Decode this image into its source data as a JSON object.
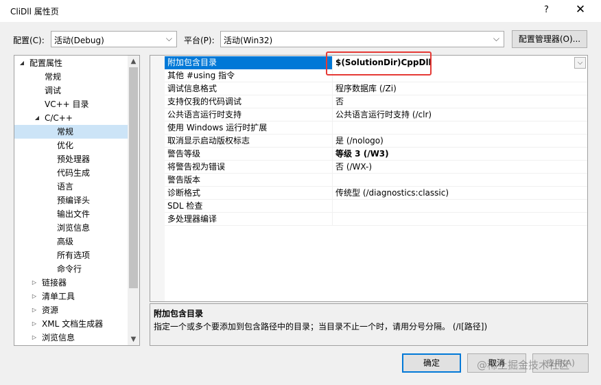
{
  "window": {
    "title": "CliDll 属性页",
    "help_label": "?",
    "close_label": "✕"
  },
  "toolbar": {
    "config_label": "配置(C):",
    "config_value": "活动(Debug)",
    "platform_label": "平台(P):",
    "platform_value": "活动(Win32)",
    "config_manager_label": "配置管理器(O)..."
  },
  "tree": {
    "items": [
      {
        "label": "配置属性",
        "expander": "◢"
      },
      {
        "label": "常规"
      },
      {
        "label": "调试"
      },
      {
        "label": "VC++ 目录"
      },
      {
        "label": "C/C++",
        "expander": "◢"
      },
      {
        "label": "常规"
      },
      {
        "label": "优化"
      },
      {
        "label": "预处理器"
      },
      {
        "label": "代码生成"
      },
      {
        "label": "语言"
      },
      {
        "label": "预编译头"
      },
      {
        "label": "输出文件"
      },
      {
        "label": "浏览信息"
      },
      {
        "label": "高级"
      },
      {
        "label": "所有选项"
      },
      {
        "label": "命令行"
      },
      {
        "label": "链接器",
        "expander": "▷"
      },
      {
        "label": "清单工具",
        "expander": "▷"
      },
      {
        "label": "资源",
        "expander": "▷"
      },
      {
        "label": "XML 文档生成器",
        "expander": "▷"
      },
      {
        "label": "浏览信息",
        "expander": "▷"
      }
    ],
    "selected_index": 5
  },
  "properties": {
    "rows": [
      {
        "name": "附加包含目录",
        "value": "$(SolutionDir)CppDll"
      },
      {
        "name": "其他 #using 指令",
        "value": ""
      },
      {
        "name": "调试信息格式",
        "value": "程序数据库 (/Zi)"
      },
      {
        "name": "支持仅我的代码调试",
        "value": "否"
      },
      {
        "name": "公共语言运行时支持",
        "value": "公共语言运行时支持 (/clr)"
      },
      {
        "name": "使用 Windows 运行时扩展",
        "value": ""
      },
      {
        "name": "取消显示启动版权标志",
        "value": "是 (/nologo)"
      },
      {
        "name": "警告等级",
        "value": "等级 3 (/W3)"
      },
      {
        "name": "将警告视为错误",
        "value": "否 (/WX-)"
      },
      {
        "name": "警告版本",
        "value": ""
      },
      {
        "name": "诊断格式",
        "value": "传统型 (/diagnostics:classic)"
      },
      {
        "name": "SDL 检查",
        "value": ""
      },
      {
        "name": "多处理器编译",
        "value": ""
      }
    ],
    "selected_index": 0
  },
  "description": {
    "title": "附加包含目录",
    "text": "指定一个或多个要添加到包含路径中的目录；当目录不止一个时，请用分号分隔。     (/I[路径])"
  },
  "buttons": {
    "ok": "确定",
    "cancel": "取消",
    "apply": "应用(A)"
  },
  "watermark": "@稀土掘金技术社区",
  "colors": {
    "selection": "#0078d7",
    "tree_selection": "#cce4f7",
    "annotation_box": "#e53935"
  }
}
